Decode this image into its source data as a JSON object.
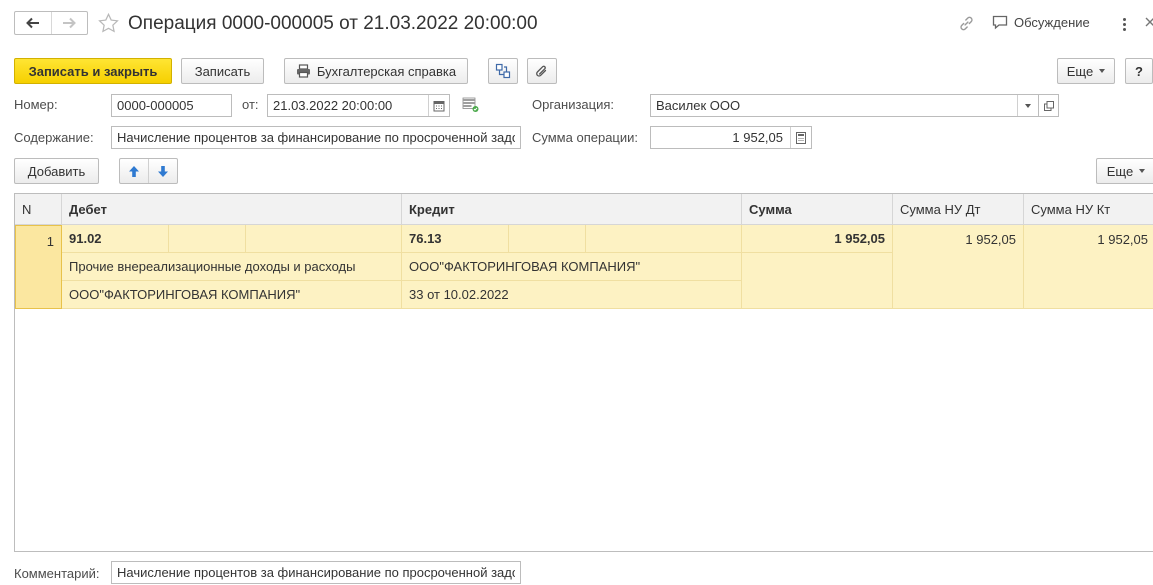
{
  "header": {
    "title": "Операция 0000-000005 от 21.03.2022 20:00:00",
    "discussion_label": "Обсуждение"
  },
  "toolbar": {
    "save_close_label": "Записать и закрыть",
    "save_label": "Записать",
    "report_label": "Бухгалтерская справка",
    "more_label": "Еще",
    "help_label": "?"
  },
  "form": {
    "number_label": "Номер:",
    "number_value": "0000-000005",
    "date_label": "от:",
    "date_value": "21.03.2022 20:00:00",
    "org_label": "Организация:",
    "org_value": "Василек ООО",
    "content_label": "Содержание:",
    "content_value": "Начисление процентов за финансирование по просроченной задолженности",
    "amount_label": "Сумма операции:",
    "amount_value": "1 952,05",
    "comment_label": "Комментарий:",
    "comment_value": "Начисление процентов за финансирование по просроченной задолженности"
  },
  "table_toolbar": {
    "add_label": "Добавить",
    "more_label": "Еще"
  },
  "table": {
    "columns": {
      "n": "N",
      "debit": "Дебет",
      "credit": "Кредит",
      "sum": "Сумма",
      "sum_nu_dt": "Сумма НУ Дт",
      "sum_nu_kt": "Сумма НУ Кт"
    },
    "rows": [
      {
        "n": "1",
        "debit_account": "91.02",
        "debit_sub1": "Прочие внереализационные доходы и расходы",
        "debit_sub2": "ООО\"ФАКТОРИНГОВАЯ КОМПАНИЯ\"",
        "credit_account": "76.13",
        "credit_sub1": "ООО\"ФАКТОРИНГОВАЯ КОМПАНИЯ\"",
        "credit_sub2": "33 от 10.02.2022",
        "sum": "1 952,05",
        "sum_nu_dt": "1 952,05",
        "sum_nu_kt": "1 952,05"
      }
    ]
  },
  "colors": {
    "primary_button": "#f6d000",
    "selected_row": "#fdf2c3",
    "header_bg": "#f2f2f2"
  }
}
